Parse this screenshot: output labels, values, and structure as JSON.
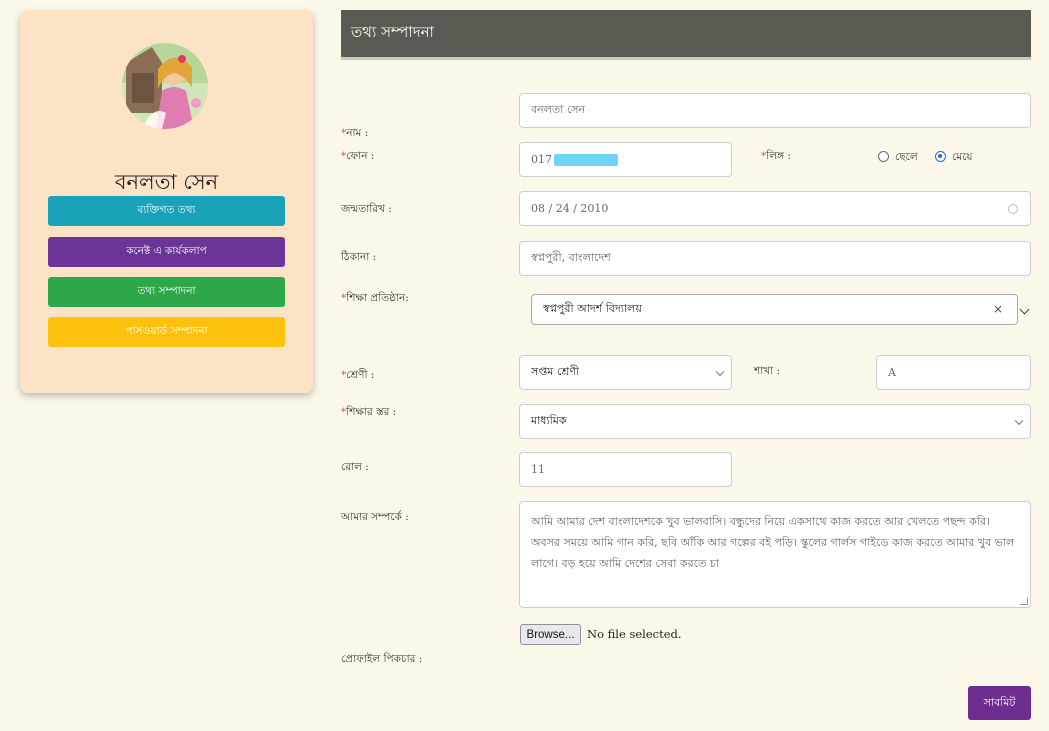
{
  "profile": {
    "name": "বনলতা সেন"
  },
  "sidebar": {
    "items": [
      {
        "label": "ব্যক্তিগত তথ্য",
        "color": "#1aa3b8"
      },
      {
        "label": "কনেক্ট এ কার্যকলাপ",
        "color": "#6b3598"
      },
      {
        "label": "তথ্য সম্পাদনা",
        "color": "#2ea64a"
      },
      {
        "label": "পাসওয়ার্ড সম্পাদনা",
        "color": "#fbc10d"
      }
    ]
  },
  "form": {
    "title": "তথ্য সম্পাদনা",
    "name_label": "নাম :",
    "name_value": "বনলতা সেন",
    "phone_label": "ফোন :",
    "phone_value": "017",
    "gender_label": "লিঙ্গ :",
    "gender_options": [
      "ছেলে",
      "মেয়ে"
    ],
    "gender_selected": "মেয়ে",
    "dob_label": "জন্মতারিখ :",
    "dob_value": "08 / 24 / 2010",
    "address_label": "ঠিকানা :",
    "address_value": "স্বপ্নপুরী, বাংলাদেশ",
    "institution_label": "শিক্ষা প্রতিষ্ঠান:",
    "institution_value": "স্বপ্নপুরী আদর্শ বিদ্যালয়",
    "institution_clear": "×",
    "class_label": "শ্রেণী :",
    "class_value": "সপ্তম শ্রেণী",
    "section_label": "শাখা :",
    "section_value": "A",
    "level_label": "শিক্ষার স্তর :",
    "level_value": "মাধ্যমিক",
    "roll_label": "রোল :",
    "roll_value": "11",
    "about_label": "আমার সম্পর্কে :",
    "about_value": "আমি আমার দেশ বাংলাদেশকে খুব ভালবাসি। বন্ধুদের নিয়ে একসাথে কাজ করতে আর খেলতে পছন্দ করি। অবসর সময়ে আমি গান করি, ছবি আঁকি আর গল্পের বই পড়ি। স্কুলের গার্লস গাইডে কাজ করতে আমার খুব ভাল লাগে। বড় হয়ে আমি দেশের সেবা করতে চা",
    "picture_label": "প্রোফাইল পিকচার :",
    "browse_label": "Browse...",
    "file_status": "No file selected.",
    "submit_label": "সাবমিট",
    "required_mark": "*"
  },
  "colors": {
    "header_bg": "#595b52",
    "card_bg": "#fde3c6",
    "submit_bg": "#6f2d91",
    "required": "#d9534f",
    "radio_checked": "#2a66d9"
  }
}
